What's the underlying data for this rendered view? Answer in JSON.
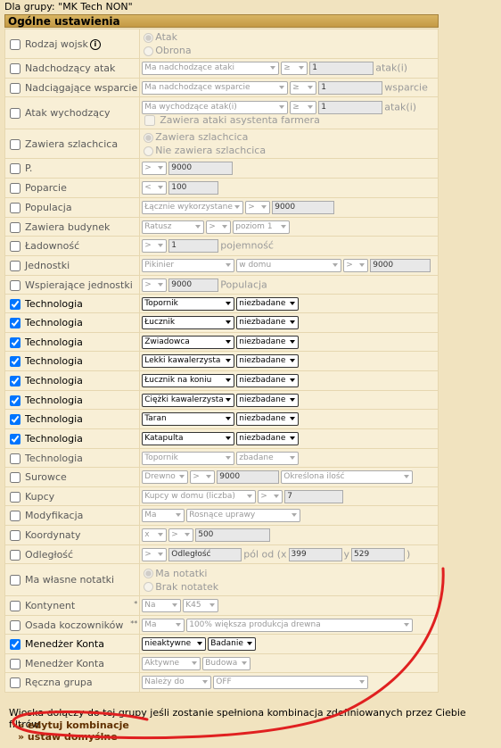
{
  "group_line": "Dla grupy: \"MK Tech NON\"",
  "section_title": "Ogólne ustawienia",
  "rows": {
    "rodzaj": {
      "label": "Rodzaj wojsk",
      "help": "i",
      "opt1": "Atak",
      "opt2": "Obrona"
    },
    "nadchodzacy": {
      "label": "Nadchodzący atak",
      "sel1": "Ma nadchodzące ataki",
      "sel2": "≥",
      "val": "1",
      "unit": "atak(i)"
    },
    "nadciagajace": {
      "label": "Nadciągające wsparcie",
      "sel1": "Ma nadchodzące wsparcie",
      "sel2": "≥",
      "val": "1",
      "unit": "wsparcie"
    },
    "wychodzacy": {
      "label": "Atak wychodzący",
      "sel1": "Ma wychodzące atak(i)",
      "sel2": "≥",
      "val": "1",
      "unit": "atak(i)",
      "check": "Zawiera ataki asystenta farmera"
    },
    "szlachcica": {
      "label": "Zawiera szlachcica",
      "opt1": "Zawiera szlachcica",
      "opt2": "Nie zawiera szlachcica"
    },
    "p": {
      "label": "P.",
      "sel1": ">",
      "val": "9000"
    },
    "poparcie": {
      "label": "Poparcie",
      "sel1": "<",
      "val": "100"
    },
    "populacja": {
      "label": "Populacja",
      "sel1": "Łącznie wykorzystane",
      "sel2": ">",
      "val": "9000"
    },
    "budynek": {
      "label": "Zawiera budynek",
      "sel1": "Ratusz",
      "sel2": ">",
      "sel3": "poziom 1"
    },
    "ladownosc": {
      "label": "Ładowność",
      "sel1": ">",
      "val": "1",
      "unit": "pojemność"
    },
    "jednostki": {
      "label": "Jednostki",
      "sel1": "Pikinier",
      "sel2": "w domu",
      "sel3": ">",
      "val": "9000"
    },
    "wspierajace": {
      "label": "Wspierające jednostki",
      "sel1": ">",
      "val": "9000",
      "unit": "Populacja"
    },
    "tech_label": "Technologia",
    "tech_status": "niezbadane",
    "tech_units": [
      "Topornik",
      "Łucznik",
      "Zwiadowca",
      "Lekki kawalerzysta",
      "Łucznik na koniu",
      "Ciężki kawalerzysta",
      "Taran",
      "Katapulta"
    ],
    "tech_off": {
      "sel1": "Topornik",
      "sel2": "zbadane"
    },
    "surowce": {
      "label": "Surowce",
      "sel1": "Drewno",
      "sel2": ">",
      "val": "9000",
      "sel3": "Określona ilość"
    },
    "kupcy": {
      "label": "Kupcy",
      "sel1": "Kupcy w domu (liczba)",
      "sel2": ">",
      "val": "7"
    },
    "modyfikacja": {
      "label": "Modyfikacja",
      "sel1": "Ma",
      "sel2": "Rosnące uprawy"
    },
    "koordynaty": {
      "label": "Koordynaty",
      "sel1": "x",
      "sel2": ">",
      "val": "500"
    },
    "odleglosc": {
      "label": "Odległość",
      "sel1": ">",
      "val": "Odległość",
      "mid": "pól od (x",
      "x": "399",
      "ylabel": "y",
      "y": "529",
      "close": ")"
    },
    "notatki": {
      "label": "Ma własne notatki",
      "opt1": "Ma notatki",
      "opt2": "Brak notatek"
    },
    "kontynent": {
      "label": "Kontynent",
      "sup": "*",
      "sel1": "Na",
      "sel2": "K45"
    },
    "osada": {
      "label": "Osada koczowników",
      "sup": "**",
      "sel1": "Ma",
      "sel2": "100% większa produkcja drewna"
    },
    "menedzer1": {
      "label": "Menedżer Konta",
      "sel1": "nieaktywne",
      "sel2": "Badanie"
    },
    "menedzer2": {
      "label": "Menedżer Konta",
      "sel1": "Aktywne",
      "sel2": "Budowa"
    },
    "reczna": {
      "label": "Ręczna grupa",
      "sel1": "Należy do",
      "sel2": "OFF"
    }
  },
  "footer_text": "Wioska dołączy do tej grupy jeśli zostanie spełniona kombinacja zdefiniowanych przez Ciebie filtrów.",
  "link_edit": "» edytuj kombinacje",
  "link_default": "» ustaw domyślne",
  "annotation_color": "#e02020"
}
